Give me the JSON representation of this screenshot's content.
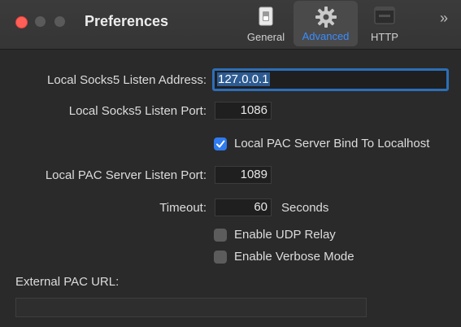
{
  "window": {
    "title": "Preferences",
    "tabs": [
      {
        "label": "General",
        "icon": "switch-icon"
      },
      {
        "label": "Advanced",
        "icon": "gear-icon",
        "selected": true
      },
      {
        "label": "HTTP",
        "icon": "http-icon"
      }
    ],
    "overflow_symbol": "»"
  },
  "form": {
    "listen_address": {
      "label": "Local Socks5 Listen Address:",
      "value": "127.0.0.1"
    },
    "listen_port": {
      "label": "Local Socks5 Listen Port:",
      "value": "1086"
    },
    "pac_bind_localhost": {
      "label": "Local PAC Server Bind To Localhost",
      "checked": true
    },
    "pac_listen_port": {
      "label": "Local PAC Server Listen Port:",
      "value": "1089"
    },
    "timeout": {
      "label": "Timeout:",
      "value": "60",
      "unit": "Seconds"
    },
    "udp_relay": {
      "label": "Enable UDP Relay",
      "checked": false
    },
    "verbose_mode": {
      "label": "Enable Verbose Mode",
      "checked": false
    },
    "external_pac_url": {
      "label": "External PAC URL:",
      "value": ""
    }
  },
  "colors": {
    "accent": "#2f7bef",
    "close_button": "#ff5f57",
    "background": "#2a2a2a"
  }
}
